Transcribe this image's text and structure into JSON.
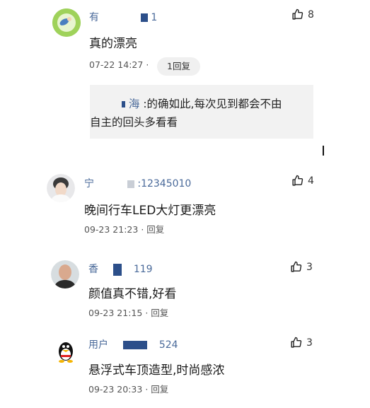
{
  "comments": [
    {
      "username_start": "有",
      "username_end": "1",
      "likes": "8",
      "content": "真的漂亮",
      "time": "07-22 14:27",
      "separator": "·",
      "reply_button": "1回复",
      "reply": {
        "name": "海",
        "text_line1": ":的确如此,每次见到都会不由",
        "text_line2": "自主的回头多看看"
      }
    },
    {
      "username_start": "宁",
      "username_end": ":12345010",
      "likes": "4",
      "content": "晚间行车LED大灯更漂亮",
      "time": "09-23 21:23",
      "separator": "·",
      "reply_link": "回复"
    },
    {
      "username_start": "香",
      "username_end": "119",
      "likes": "3",
      "content": "颜值真不错,好看",
      "time": "09-23 21:15",
      "separator": "·",
      "reply_link": "回复"
    },
    {
      "username_start": "用户",
      "username_end": "524",
      "likes": "3",
      "content": "悬浮式车顶造型,时尚感浓",
      "time": "09-23 20:33",
      "separator": "·",
      "reply_link": "回复"
    }
  ],
  "icons": {
    "like": "thumbs-up-icon"
  },
  "colors": {
    "username": "#4a6a9a",
    "text": "#1a1a1a",
    "meta": "#555555",
    "quote_bg": "#f2f2f2"
  }
}
